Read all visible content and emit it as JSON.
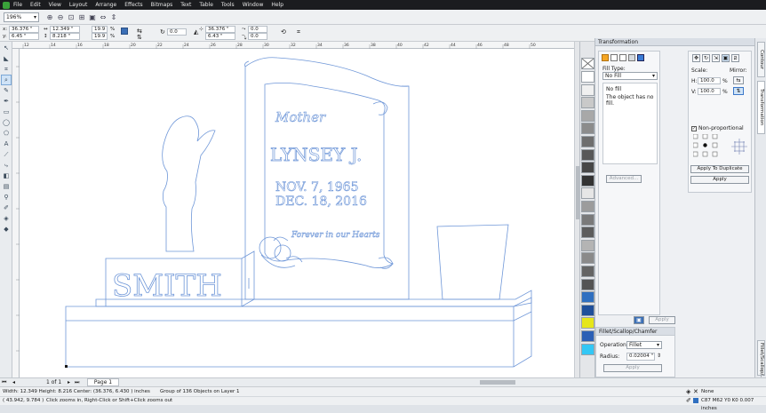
{
  "menu": [
    "File",
    "Edit",
    "View",
    "Layout",
    "Arrange",
    "Effects",
    "Bitmaps",
    "Text",
    "Table",
    "Tools",
    "Window",
    "Help"
  ],
  "toolbar": {
    "zoom_value": "196%"
  },
  "propbar": {
    "x_label": "x:",
    "x_value": "36.376 \"",
    "y_label": "y:",
    "y_value": "6.45 \"",
    "w_value": "12.349 \"",
    "h_value": "8.218 \"",
    "scale_x": "19.9",
    "scale_y": "19.9",
    "pct": "%",
    "rotate_value": "0.0",
    "pos2_x": "36.376 \"",
    "pos2_y": "6.43 \"",
    "skew_x": "0.0",
    "skew_y": "0.0"
  },
  "ruler_ticks": [
    "12",
    "14",
    "16",
    "18",
    "20",
    "22",
    "24",
    "26",
    "28",
    "30",
    "32",
    "34",
    "36",
    "38",
    "40",
    "42",
    "44",
    "46",
    "48",
    "50"
  ],
  "artwork": {
    "mother": "Mother",
    "name": "LYNSEY J.",
    "date1": "NOV. 7, 1965",
    "date2": "DEC. 18, 2016",
    "verse": "Forever in our Hearts",
    "family": "SMITH"
  },
  "palette": [
    "#ffffff",
    "#f0f0f0",
    "#c9c9c9",
    "#a8a8a8",
    "#8c8c8c",
    "#6e6e6e",
    "#585858",
    "#474747",
    "#333333",
    "#e6e6e6",
    "#9c9c9c",
    "#7a7a7a",
    "#5c5c5c",
    "#b4b4b4",
    "#8a8a8a",
    "#646464",
    "#545454",
    "#2f6fc0",
    "#1f4f9a",
    "#e6e61a",
    "#2b5fb5",
    "#33c7f5"
  ],
  "docker": {
    "title": "Transformation",
    "fill_type_label": "Fill Type:",
    "fill_type_value": "No Fill",
    "no_fill": "No fill",
    "no_fill_desc": "The object has no fill.",
    "advanced": "Advanced...",
    "apply_small": "Apply",
    "scale_label": "Scale:",
    "mirror_label": "Mirror:",
    "h_label": "H:",
    "h_value": "100.0",
    "v_label": "V:",
    "v_value": "100.0",
    "pct": "%",
    "nonprop": "Non-proportional",
    "apply_dup": "Apply To Duplicate",
    "apply": "Apply",
    "fillet_title": "Fillet/Scallop/Chamfer",
    "operation_label": "Operation:",
    "operation_value": "Fillet",
    "radius_label": "Radius:",
    "radius_value": "0.02004 \"",
    "fillet_apply": "Apply"
  },
  "side_tabs": [
    "Contour",
    "Transformation",
    "Fillet/Scallop/..."
  ],
  "pages": {
    "count": "1 of 1",
    "current": "Page 1"
  },
  "status": {
    "dimensions": "Width: 12.349  Height: 8.216  Center: (36.376, 6.430 )  inches",
    "selection": "Group of 136 Objects on Layer 1",
    "coords": "( 43.942, 9.784 )",
    "hint": "Click zooms in, Right-Click or Shift+Click zooms out",
    "fill": "None",
    "outline": "C87 M62 Y0 K0  0.007 inches"
  }
}
